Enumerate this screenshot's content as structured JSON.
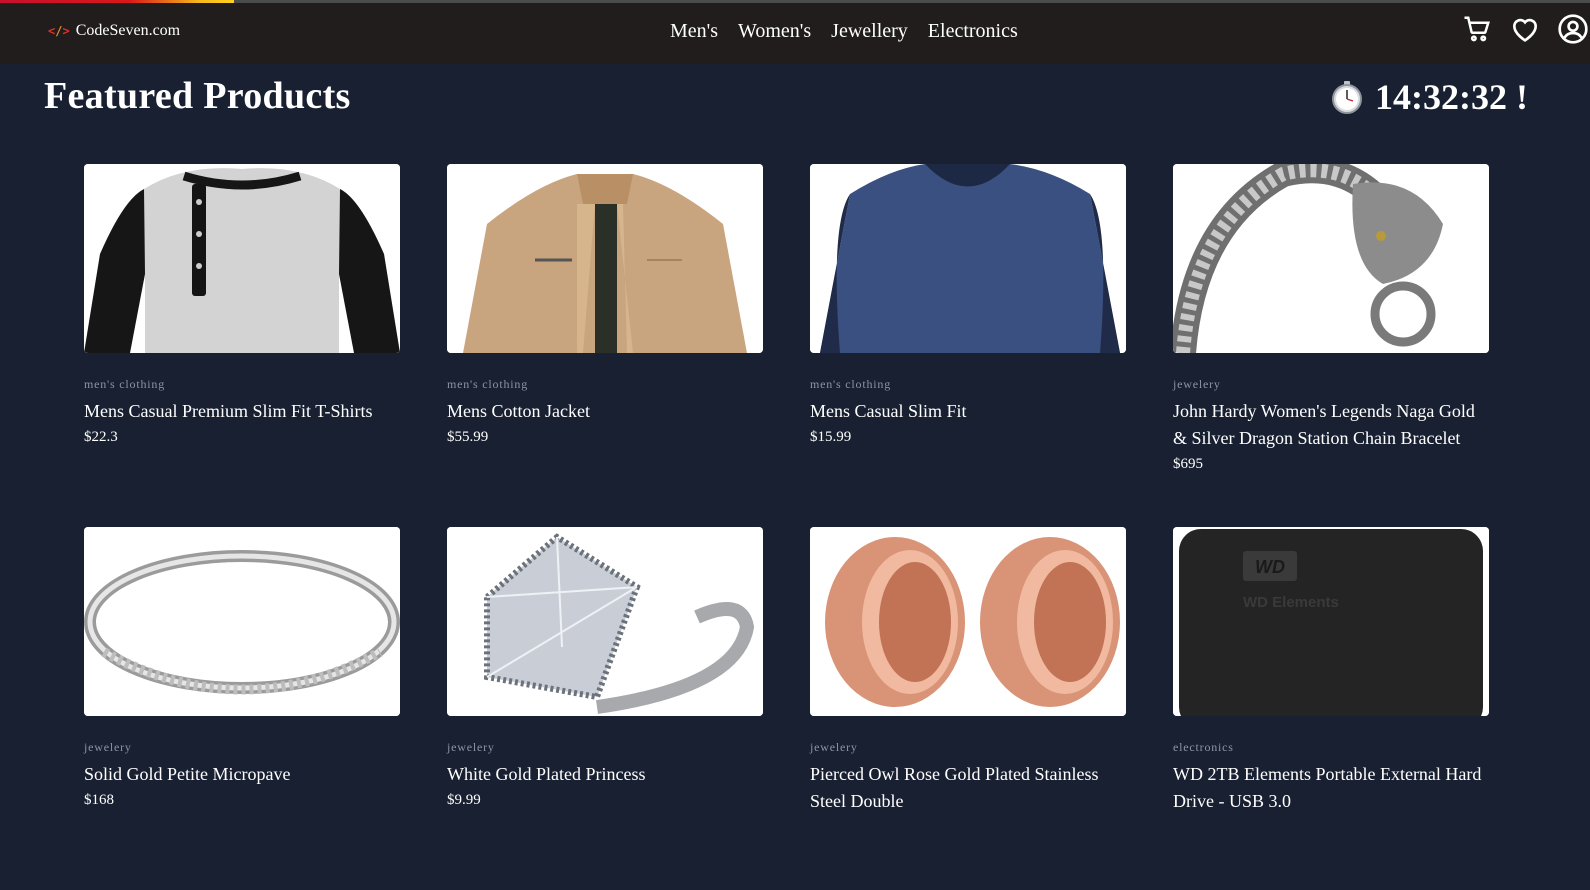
{
  "loading_progress": 0.147,
  "brand": {
    "name": "CodeSeven.com",
    "icon": "code-icon",
    "icon_text": "</>"
  },
  "nav": {
    "items": [
      "Men's",
      "Women's",
      "Jewellery",
      "Electronics"
    ]
  },
  "actions": [
    {
      "icon": "cart-icon"
    },
    {
      "icon": "heart-icon"
    },
    {
      "icon": "user-icon"
    }
  ],
  "page": {
    "title": "Featured Products"
  },
  "timer": {
    "icon": "stopwatch-icon",
    "value": "14:32:32 !"
  },
  "products": [
    {
      "category": "men's clothing",
      "title": "Mens Casual Premium Slim Fit T-Shirts",
      "price": "$22.3",
      "image": "raglan-tshirt"
    },
    {
      "category": "men's clothing",
      "title": "Mens Cotton Jacket",
      "price": "$55.99",
      "image": "cotton-jacket"
    },
    {
      "category": "men's clothing",
      "title": "Mens Casual Slim Fit",
      "price": "$15.99",
      "image": "navy-longsleeve"
    },
    {
      "category": "jewelery",
      "title": "John Hardy Women's Legends Naga Gold & Silver Dragon Station Chain Bracelet",
      "price": "$695",
      "image": "dragon-bracelet"
    },
    {
      "category": "jewelery",
      "title": "Solid Gold Petite Micropave",
      "price": "$168",
      "image": "micropave-ring"
    },
    {
      "category": "jewelery",
      "title": "White Gold Plated Princess",
      "price": "$9.99",
      "image": "princess-ring"
    },
    {
      "category": "jewelery",
      "title": "Pierced Owl Rose Gold Plated Stainless Steel Double",
      "price": "",
      "image": "rose-gold-plugs"
    },
    {
      "category": "electronics",
      "title": "WD 2TB Elements Portable External Hard Drive - USB 3.0",
      "price": "",
      "image": "wd-hard-drive",
      "image_text": "WD Elements"
    }
  ]
}
